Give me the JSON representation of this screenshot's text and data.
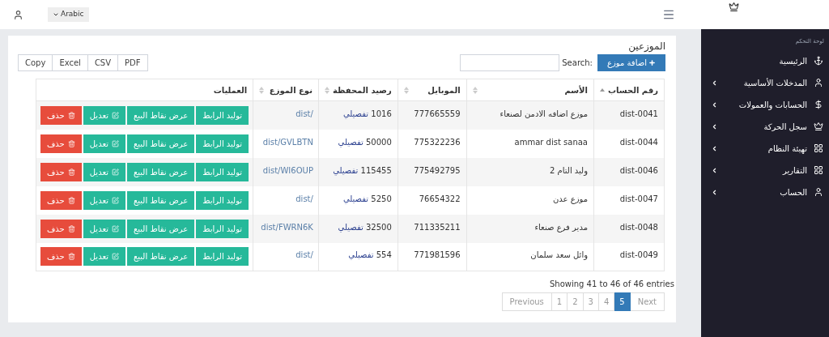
{
  "header": {
    "language": "Arabic"
  },
  "sidebar": {
    "heading": "لوحة التحكم",
    "items": [
      {
        "label": "الرئيسية",
        "expandable": false
      },
      {
        "label": "المدخلات الأساسية",
        "expandable": true
      },
      {
        "label": "الحسابات والعمولات",
        "expandable": true
      },
      {
        "label": "سجل الحركة",
        "expandable": true
      },
      {
        "label": "تهيئة النظام",
        "expandable": true
      },
      {
        "label": "التقارير",
        "expandable": true
      },
      {
        "label": "الحساب",
        "expandable": true
      }
    ]
  },
  "page": {
    "title": "الموزعين",
    "add_button": "اضافة موزع",
    "search_label": "Search:",
    "export_buttons": [
      "PDF",
      "CSV",
      "Excel",
      "Copy"
    ]
  },
  "table": {
    "columns": [
      {
        "label": "رقم الحساب",
        "sortable": true,
        "sorted": true
      },
      {
        "label": "الأسم",
        "sortable": true,
        "sorted": false
      },
      {
        "label": "الموبايل",
        "sortable": true,
        "sorted": false
      },
      {
        "label": "رصيد المحفظة",
        "sortable": true,
        "sorted": false
      },
      {
        "label": "نوع الموزع",
        "sortable": true,
        "sorted": false
      },
      {
        "label": "العمليات",
        "sortable": false
      }
    ],
    "rows": [
      {
        "account": "dist-0041",
        "name": "موزع اضافه الادمن لصنعاء",
        "mobile": "777665559",
        "balance": "1016",
        "detail_link": "تفصيلي",
        "type": "/dist",
        "actions": [
          {
            "label": "توليد الرابط",
            "kind": "primary"
          },
          {
            "label": "عرض نقاط البيع",
            "kind": "primary"
          },
          {
            "label": "تعديل",
            "kind": "edit"
          },
          {
            "label": "حذف",
            "kind": "delete"
          }
        ]
      },
      {
        "account": "dist-0044",
        "name": "ammar dist sanaa",
        "mobile": "775322236",
        "balance": "50000",
        "detail_link": "تفصيلي",
        "type": "dist/GVLBTN",
        "actions": [
          {
            "label": "توليد الرابط",
            "kind": "primary"
          },
          {
            "label": "عرض نقاط البيع",
            "kind": "primary"
          },
          {
            "label": "تعديل",
            "kind": "edit"
          },
          {
            "label": "حذف",
            "kind": "delete"
          }
        ]
      },
      {
        "account": "dist-0046",
        "name": "وليد التام 2",
        "mobile": "775492795",
        "balance": "115455",
        "detail_link": "تفصيلي",
        "type": "dist/WI6OUP",
        "actions": [
          {
            "label": "توليد الرابط",
            "kind": "primary"
          },
          {
            "label": "عرض نقاط البيع",
            "kind": "primary"
          },
          {
            "label": "تعديل",
            "kind": "edit"
          },
          {
            "label": "حذف",
            "kind": "delete"
          }
        ]
      },
      {
        "account": "dist-0047",
        "name": "موزع عدن",
        "mobile": "76654322",
        "balance": "5250",
        "detail_link": "تفصيلي",
        "type": "/dist",
        "actions": [
          {
            "label": "توليد الرابط",
            "kind": "primary"
          },
          {
            "label": "عرض نقاط البيع",
            "kind": "primary"
          },
          {
            "label": "تعديل",
            "kind": "edit"
          },
          {
            "label": "حذف",
            "kind": "delete"
          }
        ]
      },
      {
        "account": "dist-0048",
        "name": "مدير فرع صنعاء",
        "mobile": "711335211",
        "balance": "32500",
        "detail_link": "تفصيلي",
        "type": "dist/FWRN6K",
        "actions": [
          {
            "label": "توليد الرابط",
            "kind": "primary"
          },
          {
            "label": "عرض نقاط البيع",
            "kind": "primary"
          },
          {
            "label": "تعديل",
            "kind": "edit"
          },
          {
            "label": "حذف",
            "kind": "delete"
          }
        ]
      },
      {
        "account": "dist-0049",
        "name": "وائل سعد سلمان",
        "mobile": "771981596",
        "balance": "554",
        "detail_link": "تفصيلي",
        "type": "/dist",
        "actions": [
          {
            "label": "توليد الرابط",
            "kind": "primary"
          },
          {
            "label": "عرض نقاط البيع",
            "kind": "primary"
          },
          {
            "label": "تعديل",
            "kind": "edit"
          },
          {
            "label": "حذف",
            "kind": "delete"
          }
        ]
      }
    ]
  },
  "info": "Showing 41 to 46 of 46 entries",
  "pagination": [
    {
      "label": "Next",
      "kind": "nav",
      "selected": false
    },
    {
      "label": "5",
      "kind": "page",
      "selected": true
    },
    {
      "label": "4",
      "kind": "page",
      "selected": false
    },
    {
      "label": "3",
      "kind": "page",
      "selected": false
    },
    {
      "label": "2",
      "kind": "page",
      "selected": false
    },
    {
      "label": "1",
      "kind": "page",
      "selected": false
    },
    {
      "label": "Previous",
      "kind": "nav",
      "selected": false
    }
  ]
}
